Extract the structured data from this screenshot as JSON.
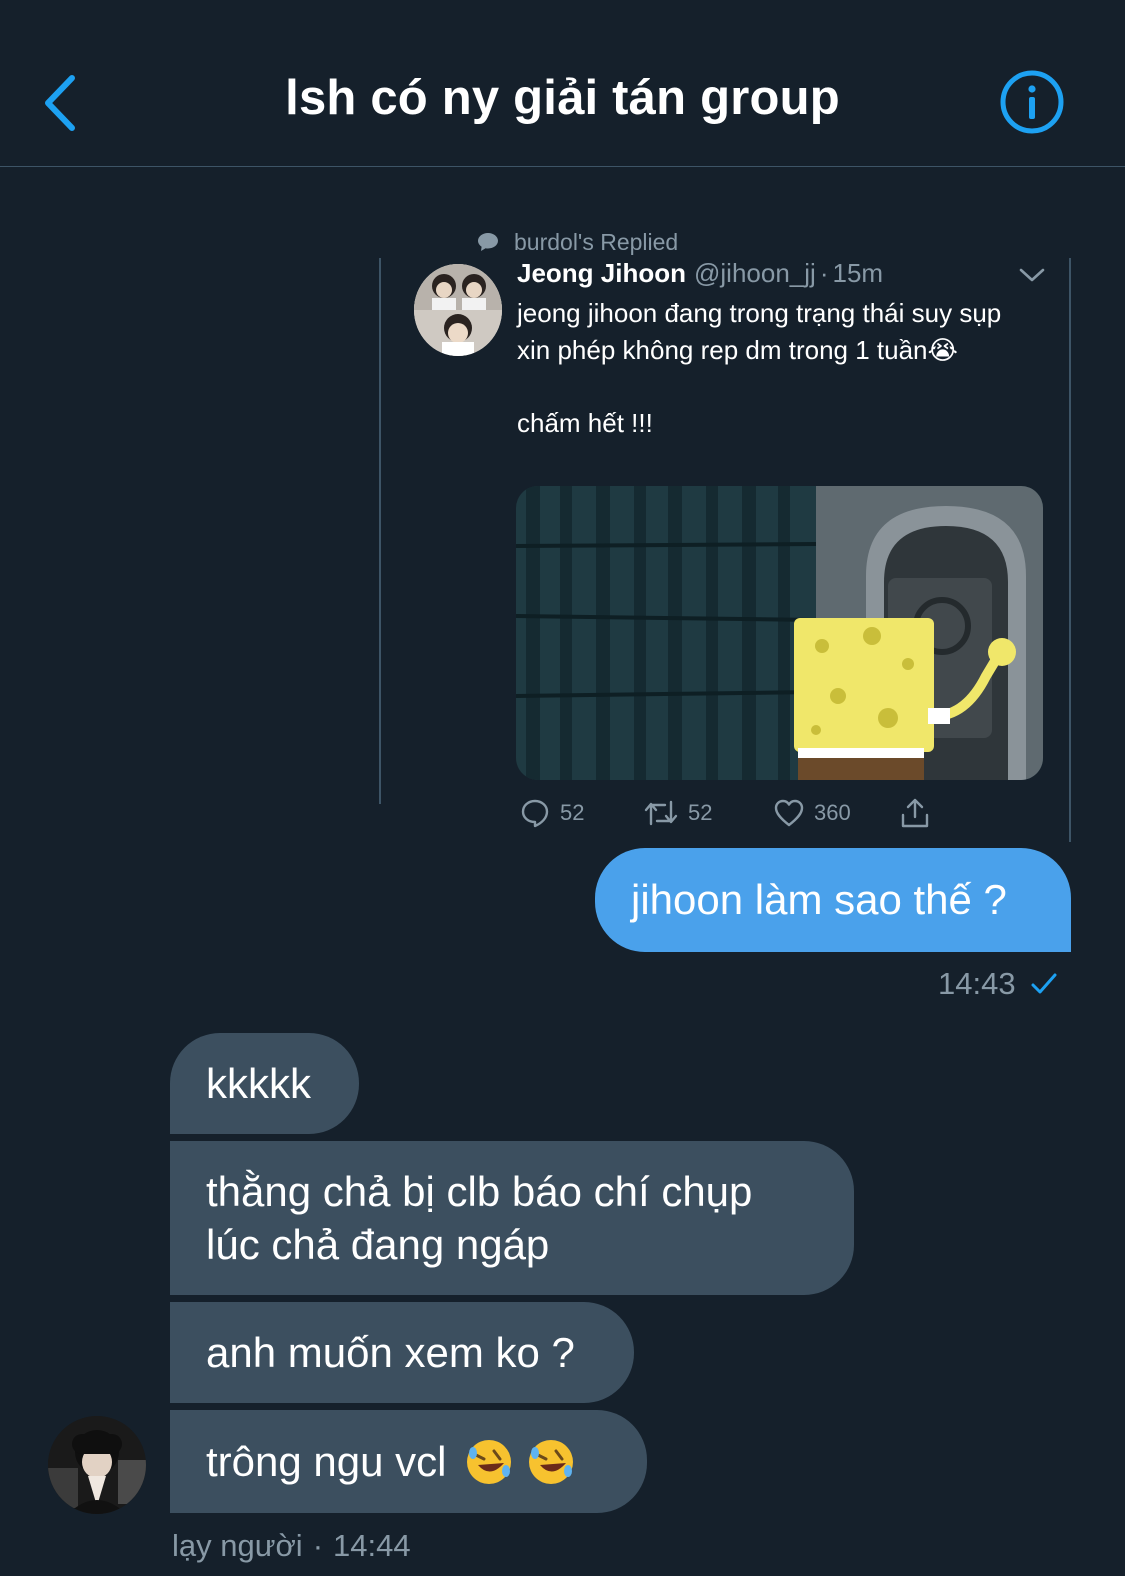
{
  "header": {
    "title": "lsh có ny giải tán group",
    "back_icon": "chevron-left-icon",
    "info_icon": "info-circle-icon",
    "accent": "#1da1f2"
  },
  "quoted_tweet": {
    "reply_context": "burdol's Replied",
    "author_name": "Jeong Jihoon",
    "author_handle": "@jihoon_jj",
    "separator": "·",
    "time": "15m",
    "text_lines": [
      "jeong jihoon đang trong trạng thái suy sụp",
      "xin phép không rep dm trong 1 tuần😭",
      "",
      "chấm hết !!!"
    ],
    "actions": {
      "replies": "52",
      "retweets": "52",
      "likes": "360"
    }
  },
  "sent": {
    "text": "jihoon làm sao thế ?",
    "time": "14:43",
    "status_icon": "checkmark-icon",
    "color": "#4aa1eb"
  },
  "received": {
    "messages": [
      "kkkkk",
      "thằng chả bị clb báo chí chụp lúc chả đang ngáp",
      "anh muốn xem ko ?",
      "trông ngu vcl"
    ],
    "sender_name": "lạy người",
    "separator": "·",
    "time": "14:44",
    "color": "#3c4f5f"
  }
}
